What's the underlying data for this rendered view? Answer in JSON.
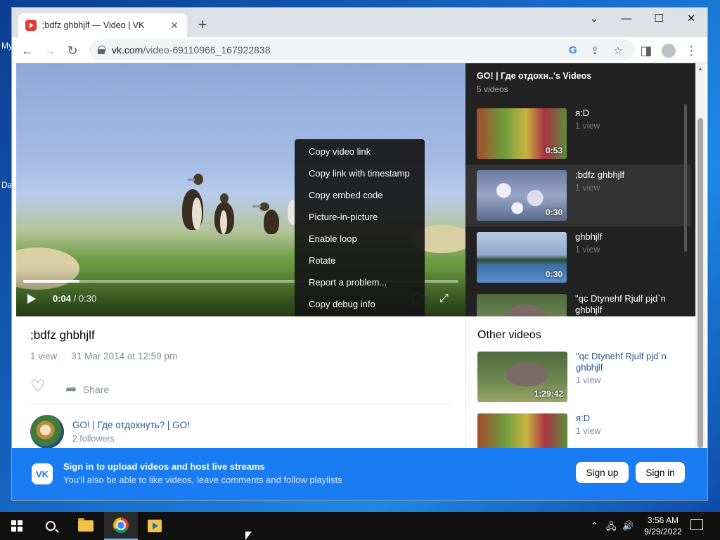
{
  "desktop": {
    "label_1": "My",
    "label_2": "Da"
  },
  "browser": {
    "tab_title": ";bdfz ghbhjlf — Video | VK",
    "tab_close": "✕",
    "new_tab": "+",
    "url_host": "vk.com",
    "url_path": "/video-69110966_167922838",
    "win_minimize": "—",
    "win_maximize": "☐",
    "win_close": "✕",
    "tab_search": "⌄"
  },
  "video": {
    "current_time": "0:04",
    "separator": " / ",
    "duration": "0:30",
    "progress": 0.13
  },
  "context_menu": {
    "items": [
      "Copy video link",
      "Copy link with timestamp",
      "Copy embed code",
      "Picture-in-picture",
      "Enable loop",
      "Rotate",
      "Report a problem...",
      "Copy debug info"
    ]
  },
  "playlist": {
    "title": "GO! | Где отдохн..'s Videos",
    "count": "5 videos",
    "items": [
      {
        "name": "я:D",
        "views": "1 view",
        "duration": "0:53"
      },
      {
        "name": ";bdfz ghbhjlf",
        "views": "1 view",
        "duration": "0:30"
      },
      {
        "name": "ghbhjlf",
        "views": "1 view",
        "duration": "0:30"
      },
      {
        "name": "\"qc Dtynehf Rjulf pjd`n ghbhjlf",
        "views": "",
        "duration": ""
      }
    ]
  },
  "info": {
    "title": ";bdfz ghbhjlf",
    "views": "1 view",
    "dot": "·",
    "date": "31 Mar 2014 at 12:59 pm",
    "share_label": "Share",
    "channel_name": "GO! | Где отдохнуть? | GO!",
    "followers": "2 followers"
  },
  "other_videos": {
    "title": "Other videos",
    "items": [
      {
        "name": "\"qc Dtynehf Rjulf pjd`n ghbhjlf",
        "views": "1 view",
        "duration": "1:29:42"
      },
      {
        "name": "я:D",
        "views": "1 view",
        "duration": ""
      }
    ]
  },
  "banner": {
    "logo": "VK",
    "title": "Sign in to upload videos and host live streams",
    "subtitle": "You'll also be able to like videos, leave comments and follow playlists",
    "sign_up": "Sign up",
    "sign_in": "Sign in"
  },
  "taskbar": {
    "time": "3:56 AM",
    "date": "9/29/2022",
    "tray_chevron": "⌃",
    "tray_net": "🖧",
    "tray_vol": "🔊"
  },
  "colors": {
    "vk_blue": "#1a7cf2",
    "link": "#2a5885",
    "muted": "#818c99"
  }
}
